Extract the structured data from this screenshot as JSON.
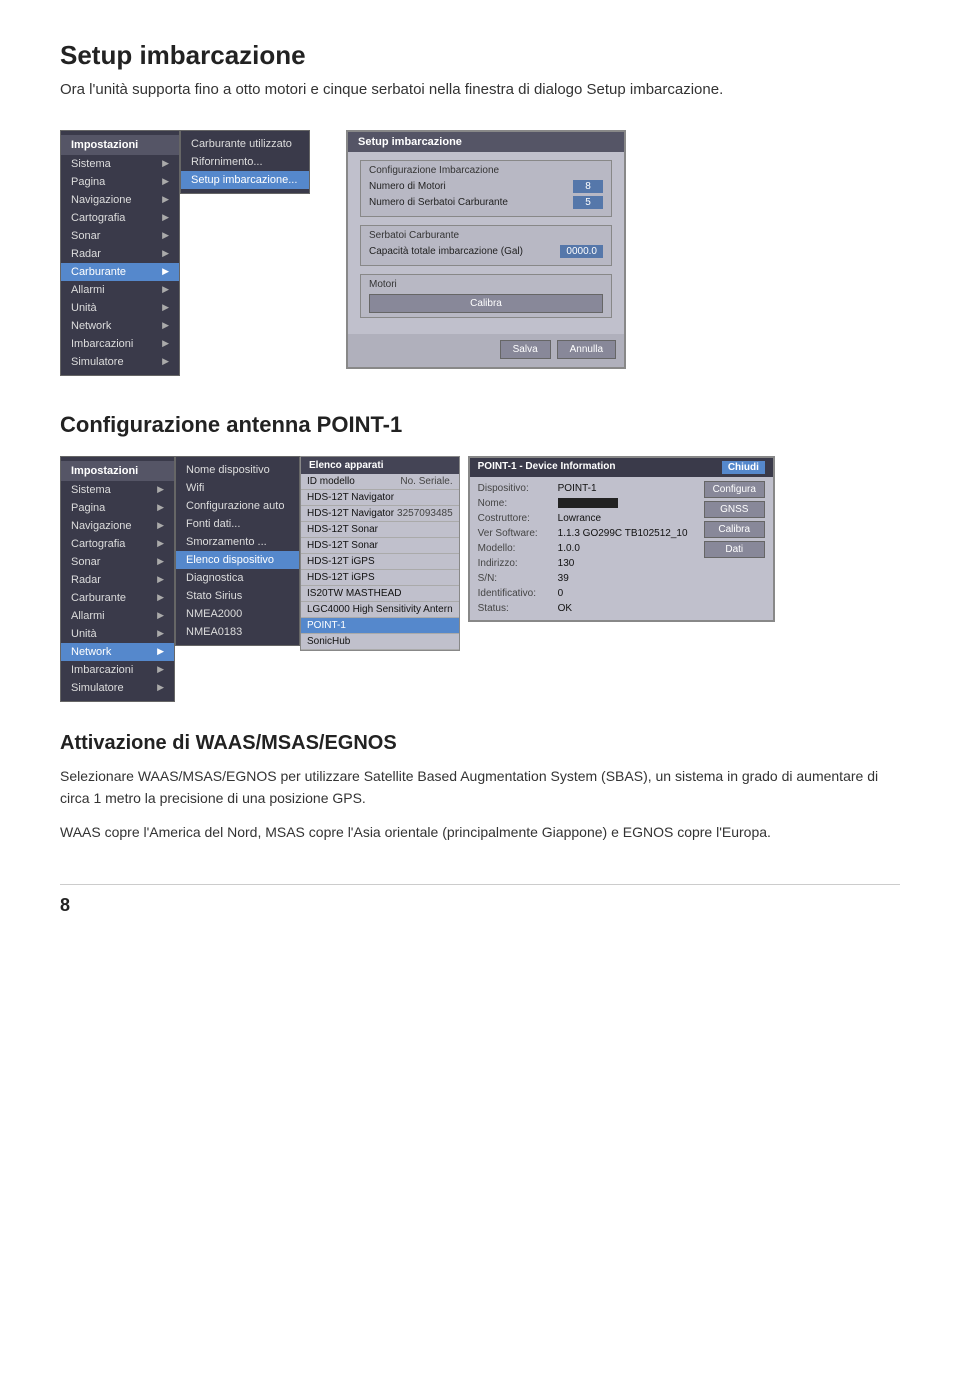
{
  "page": {
    "title1": "Setup imbarcazione",
    "desc1": "Ora l'unità supporta fino a otto motori e cinque serbatoi nella finestra di dialogo Setup imbarcazione.",
    "title2": "Configurazione antenna POINT-1",
    "title3": "Attivazione di WAAS/MSAS/EGNOS",
    "desc3a": "Selezionare WAAS/MSAS/EGNOS per utilizzare Satellite Based Augmentation System (SBAS), un sistema in grado di aumentare di circa 1 metro la precisione di una posizione GPS.",
    "desc3b": "WAAS copre l'America del Nord, MSAS copre l'Asia orientale (principalmente Giappone) e EGNOS copre l'Europa.",
    "page_number": "8"
  },
  "menu1": {
    "header": "Impostazioni",
    "items": [
      {
        "label": "Sistema",
        "arrow": true,
        "highlighted": false
      },
      {
        "label": "Pagina",
        "arrow": true,
        "highlighted": false
      },
      {
        "label": "Navigazione",
        "arrow": true,
        "highlighted": false
      },
      {
        "label": "Cartografia",
        "arrow": true,
        "highlighted": false
      },
      {
        "label": "Sonar",
        "arrow": true,
        "highlighted": false
      },
      {
        "label": "Radar",
        "arrow": true,
        "highlighted": false
      },
      {
        "label": "Carburante",
        "arrow": true,
        "highlighted": true
      },
      {
        "label": "Allarmi",
        "arrow": true,
        "highlighted": false
      },
      {
        "label": "Unità",
        "arrow": true,
        "highlighted": false
      },
      {
        "label": "Network",
        "arrow": true,
        "highlighted": false
      },
      {
        "label": "Imbarcazioni",
        "arrow": true,
        "highlighted": false
      },
      {
        "label": "Simulatore",
        "arrow": true,
        "highlighted": false
      }
    ]
  },
  "submenu1": {
    "items": [
      {
        "label": "Carburante utilizzato",
        "highlighted": false
      },
      {
        "label": "Rifornimento...",
        "highlighted": false
      },
      {
        "label": "Setup imbarcazione...",
        "highlighted": true
      }
    ]
  },
  "setup_dialog": {
    "title": "Setup imbarcazione",
    "group1_title": "Configurazione Imbarcazione",
    "field1_label": "Numero di Motori",
    "field1_value": "8",
    "field2_label": "Numero di Serbatoi Carburante",
    "field2_value": "5",
    "group2_title": "Serbatoi Carburante",
    "field3_label": "Capacità totale imbarcazione (Gal)",
    "field3_value": "0000.0",
    "group3_title": "Motori",
    "calibra_label": "Calibra",
    "btn_salva": "Salva",
    "btn_annulla": "Annulla"
  },
  "menu2": {
    "header": "Impostazioni",
    "items": [
      {
        "label": "Sistema",
        "arrow": true,
        "highlighted": false
      },
      {
        "label": "Pagina",
        "arrow": true,
        "highlighted": false
      },
      {
        "label": "Navigazione",
        "arrow": true,
        "highlighted": false
      },
      {
        "label": "Cartografia",
        "arrow": true,
        "highlighted": false
      },
      {
        "label": "Sonar",
        "arrow": true,
        "highlighted": false
      },
      {
        "label": "Radar",
        "arrow": true,
        "highlighted": false
      },
      {
        "label": "Carburante",
        "arrow": true,
        "highlighted": false
      },
      {
        "label": "Allarmi",
        "arrow": true,
        "highlighted": false
      },
      {
        "label": "Unità",
        "arrow": true,
        "highlighted": false
      },
      {
        "label": "Network",
        "arrow": true,
        "highlighted": true
      },
      {
        "label": "Imbarcazioni",
        "arrow": true,
        "highlighted": false
      },
      {
        "label": "Simulatore",
        "arrow": true,
        "highlighted": false
      }
    ]
  },
  "nome_menu": {
    "items": [
      {
        "label": "Nome dispositivo",
        "highlighted": false
      },
      {
        "label": "Wifi",
        "highlighted": false
      },
      {
        "label": "Configurazione auto",
        "highlighted": false
      },
      {
        "label": "Fonti dati...",
        "highlighted": false
      },
      {
        "label": "Smorzamento ...",
        "highlighted": false
      },
      {
        "label": "Elenco dispositivo",
        "highlighted": true
      },
      {
        "label": "Diagnostica",
        "highlighted": false
      },
      {
        "label": "Stato Sirius",
        "highlighted": false
      },
      {
        "label": "NMEA2000",
        "highlighted": false
      },
      {
        "label": "NMEA0183",
        "highlighted": false
      }
    ]
  },
  "elenco": {
    "header_left": "Elenco apparati",
    "col_id": "ID modello",
    "col_serial": "No. Seriale.",
    "rows": [
      {
        "id": "HDS-12T Navigator",
        "serial": "",
        "highlighted": false
      },
      {
        "id": "HDS-12T Navigator",
        "serial": "3257093485",
        "highlighted": false
      },
      {
        "id": "HDS-12T Sonar",
        "serial": "",
        "highlighted": false
      },
      {
        "id": "HDS-12T Sonar",
        "serial": "",
        "highlighted": false
      },
      {
        "id": "HDS-12T iGPS",
        "serial": "",
        "highlighted": false
      },
      {
        "id": "HDS-12T iGPS",
        "serial": "",
        "highlighted": false
      },
      {
        "id": "IS20TW MASTHEAD",
        "serial": "",
        "highlighted": false
      },
      {
        "id": "LGC4000 High Sensitivity Antern",
        "serial": "",
        "highlighted": false
      },
      {
        "id": "POINT-1",
        "serial": "",
        "highlighted": true
      },
      {
        "id": "SonicHub",
        "serial": "",
        "highlighted": false
      }
    ]
  },
  "device_info": {
    "title": "POINT-1 - Device Information",
    "close_label": "Chiudi",
    "fields": [
      {
        "label": "Dispositivo:",
        "value": "POINT-1"
      },
      {
        "label": "Nome:",
        "value": ""
      },
      {
        "label": "Costruttore:",
        "value": "Lowrance"
      },
      {
        "label": "Ver Software:",
        "value": "1.1.3 GO299C TB102512_10"
      },
      {
        "label": "Modello:",
        "value": "1.0.0"
      },
      {
        "label": "Indirizzo:",
        "value": "130"
      },
      {
        "label": "S/N:",
        "value": "39"
      },
      {
        "label": "Identificativo:",
        "value": "0"
      },
      {
        "label": "Status:",
        "value": "OK"
      }
    ],
    "buttons": [
      "Configura",
      "GNSS",
      "Calibra",
      "Dati"
    ]
  }
}
